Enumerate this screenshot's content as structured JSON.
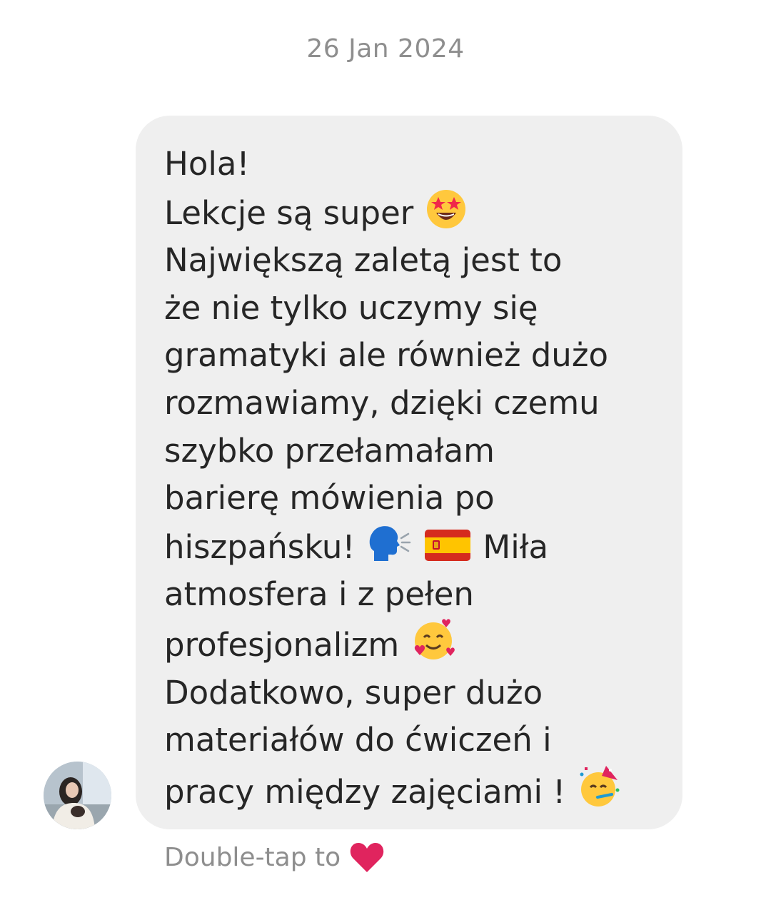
{
  "header": {
    "date": "26 Jan 2024"
  },
  "message": {
    "sender_avatar": "avatar-photo",
    "lines": [
      "Hola!",
      "Lekcje są super",
      "Największą zaletą jest to",
      "że nie tylko uczymy się",
      "gramatyki ale również dużo",
      "rozmawiamy, dzięki czemu",
      "szybko przełamałam",
      "barierę mówienia po",
      "hiszpańsku!",
      "Miła",
      "atmosfera i z pełen",
      "profesjonalizm",
      "Dodatkowo, super dużo",
      "materiałów do ćwiczeń i",
      "pracy między zajęciami !"
    ],
    "emojis": {
      "star_struck": "star-struck-emoji",
      "speaking_head": "speaking-head-emoji",
      "spain_flag": "spain-flag-emoji",
      "smiling_hearts": "smiling-face-with-hearts-emoji",
      "partying_face": "partying-face-emoji"
    },
    "bubble_color": "#efefef"
  },
  "footer": {
    "reaction_hint": "Double-tap to",
    "reaction_icon": "red-heart-icon"
  },
  "colors": {
    "text": "#262626",
    "muted": "#8e8e8e",
    "heart": "#e0245e"
  }
}
